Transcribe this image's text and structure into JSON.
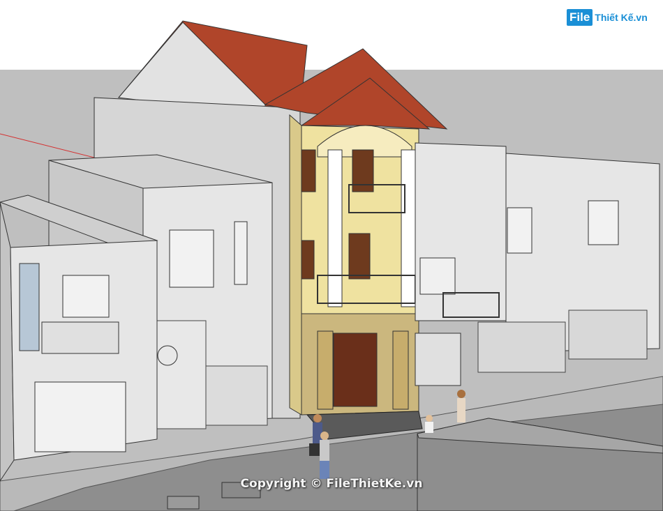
{
  "logo": {
    "box_text": "File",
    "rest_text": "Thiết Kế.vn",
    "color": "#1a8fd6"
  },
  "watermark": {
    "text": "Copyright © FileThietKe.vn"
  },
  "colors": {
    "sky": "#ffffff",
    "backdrop": "#bfbfbf",
    "roof": "#b0452a",
    "facade": "#efe2a0",
    "ground_floor": "#cbb77e",
    "neighbor_wall": "#e6e6e6",
    "road": "#8c8c8c",
    "sidewalk": "#b9b9b9",
    "axis_line": "#d43030"
  }
}
